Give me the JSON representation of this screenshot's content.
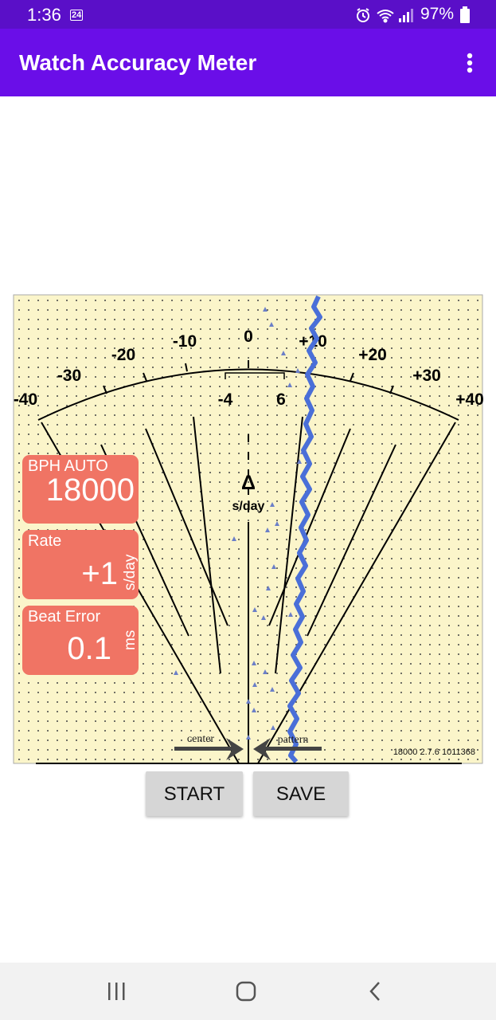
{
  "status_bar": {
    "time": "1:36",
    "notification": "24",
    "battery": "97%"
  },
  "app_bar": {
    "title": "Watch Accuracy Meter",
    "menu_icon": "more-vert-icon"
  },
  "meter": {
    "scale_labels": [
      "-40",
      "-30",
      "-20",
      "-10",
      "0",
      "+10",
      "+20",
      "+30",
      "+40"
    ],
    "zoom_labels": [
      "-4",
      "6"
    ],
    "delta_symbol": "Δ",
    "delta_unit": "s/day",
    "center_label": "center",
    "pattern_label": "pattern",
    "version_text": "18000 2.7.6 1011368"
  },
  "readouts": {
    "bph": {
      "label": "BPH AUTO",
      "value": "18000"
    },
    "rate": {
      "label": "Rate",
      "value": "+1",
      "unit": "s/day"
    },
    "beat_error": {
      "label": "Beat Error",
      "value": "0.1",
      "unit": "ms"
    }
  },
  "buttons": {
    "start": "START",
    "save": "SAVE"
  },
  "nav_bar": {
    "recent": "recent-apps-icon",
    "home": "home-icon",
    "back": "back-icon"
  },
  "colors": {
    "status_bar": "#5a0fc8",
    "app_bar": "#6a0ee8",
    "meter_bg": "#fbf5ca",
    "readout": "#f07464",
    "trace": "#4a6fd8"
  }
}
